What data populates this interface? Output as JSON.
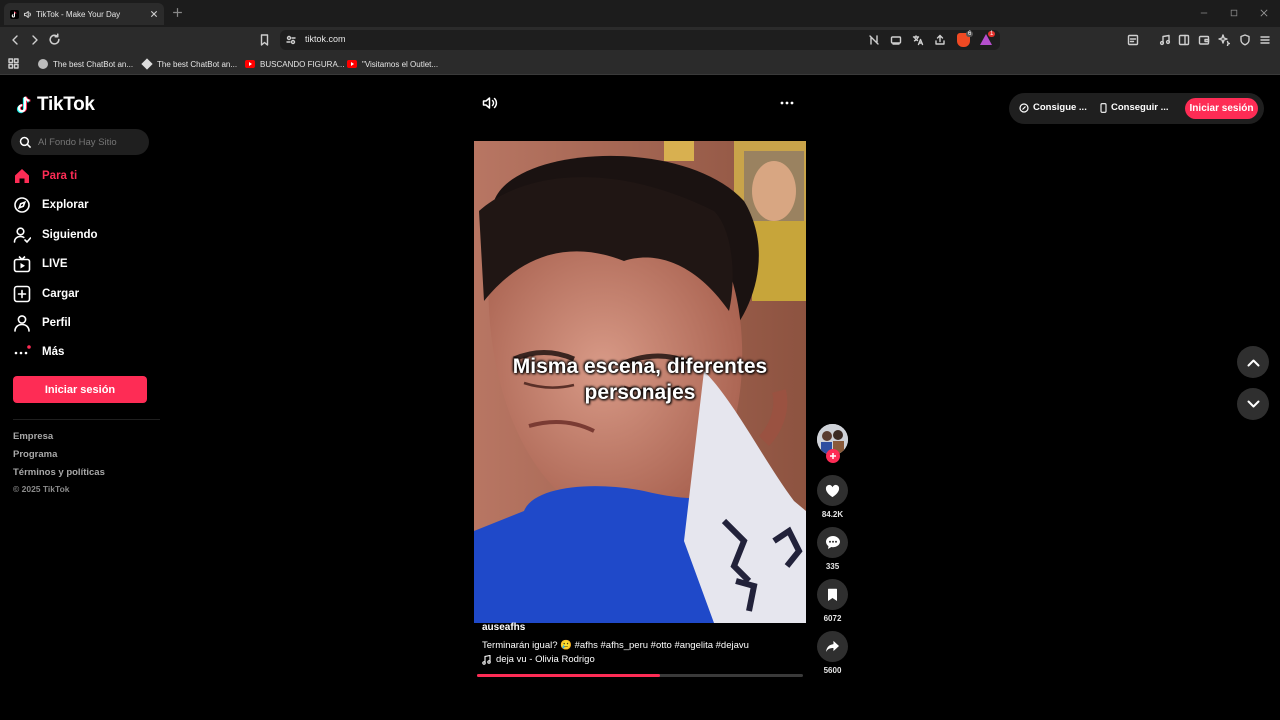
{
  "browser": {
    "tab_title": "TikTok - Make Your Day",
    "url": "tiktok.com",
    "badge_shield": "6",
    "badge_triangle": "1",
    "bookmarks": [
      {
        "label": "The best ChatBot an...",
        "icon": "globe-icon"
      },
      {
        "label": "The best ChatBot an...",
        "icon": "diamond-icon"
      },
      {
        "label": "BUSCANDO FIGURA...",
        "icon": "youtube-icon"
      },
      {
        "label": "\"Visitamos el Outlet...",
        "icon": "youtube-icon"
      }
    ]
  },
  "tiktok": {
    "logo": "TikTok",
    "search_placeholder": "Al Fondo Hay Sitio",
    "nav": [
      {
        "label": "Para ti",
        "icon": "home-icon",
        "active": true
      },
      {
        "label": "Explorar",
        "icon": "compass-icon"
      },
      {
        "label": "Siguiendo",
        "icon": "following-icon"
      },
      {
        "label": "LIVE",
        "icon": "live-icon"
      },
      {
        "label": "Cargar",
        "icon": "upload-icon"
      },
      {
        "label": "Perfil",
        "icon": "profile-icon"
      },
      {
        "label": "Más",
        "icon": "more-icon"
      }
    ],
    "login_button": "Iniciar sesión",
    "footer": [
      "Empresa",
      "Programa",
      "Términos y políticas",
      "© 2025 TikTok"
    ],
    "header_buttons": {
      "coins": "Consigue ...",
      "app": "Conseguir ...",
      "login": "Iniciar sesión"
    },
    "accent": "#fe2c55",
    "video": {
      "caption_overlay": [
        "Misma escena, diferentes",
        "personajes"
      ],
      "username": "auseafhs",
      "description": "Terminarán igual? 🥲 #afhs #afhs_peru #otto #angelita #dejavu",
      "sound": "deja vu - Olivia Rodrigo",
      "progress": 0.56
    },
    "actions": {
      "likes": "84.2K",
      "comments": "335",
      "saves": "6072",
      "shares": "5600"
    }
  }
}
